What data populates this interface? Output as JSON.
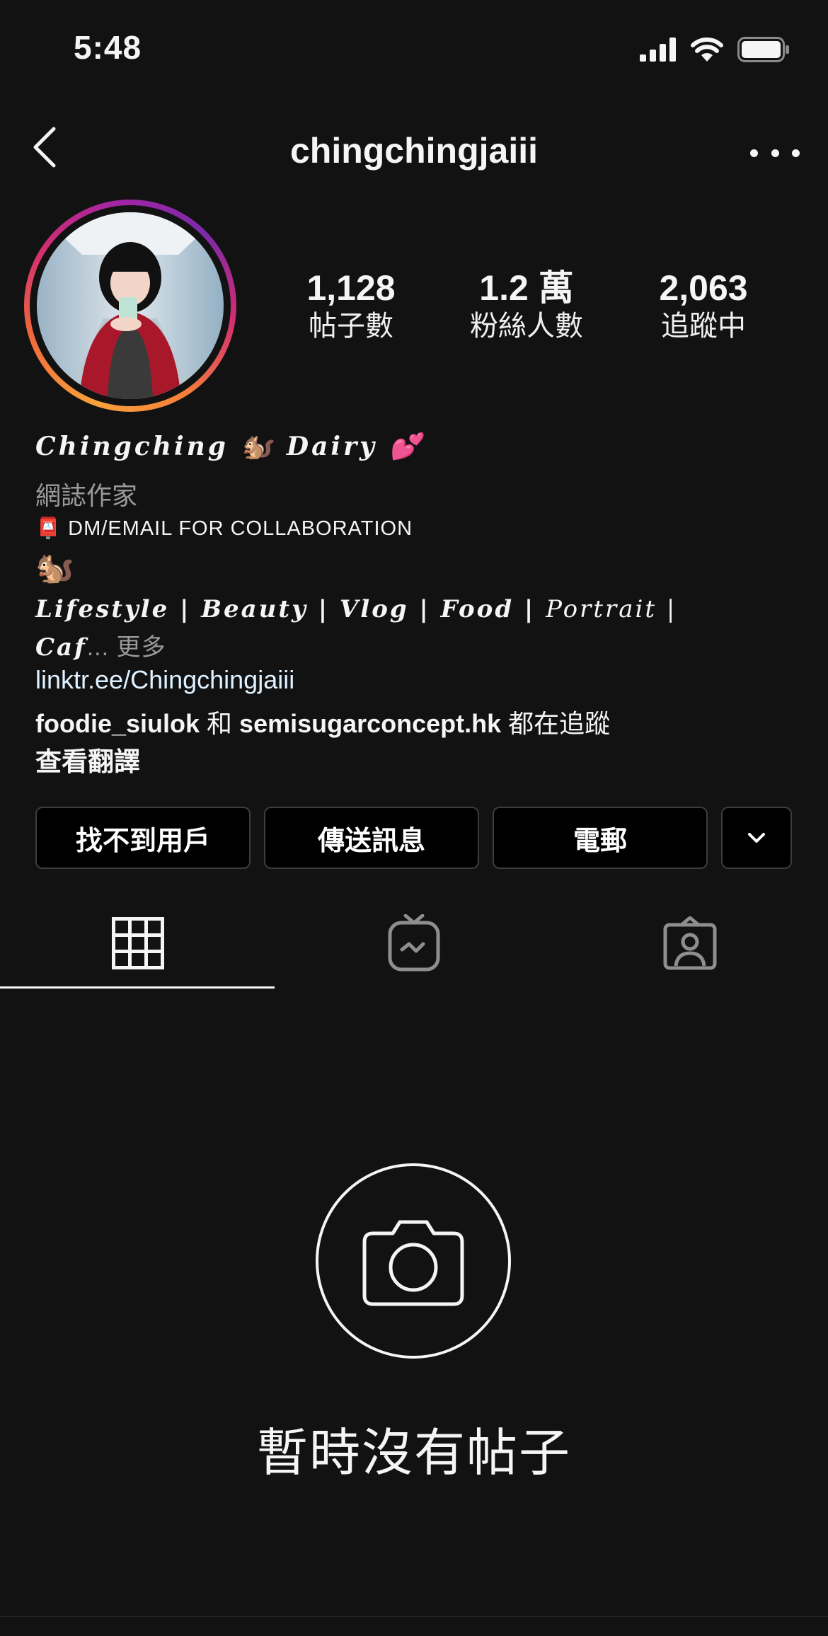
{
  "status_bar": {
    "time": "5:48"
  },
  "header": {
    "username": "chingchingjaiii"
  },
  "stats": [
    {
      "value": "1,128",
      "label": "帖子數"
    },
    {
      "value": "1.2 萬",
      "label": "粉絲人數"
    },
    {
      "value": "2,063",
      "label": "追蹤中"
    }
  ],
  "bio": {
    "display_name": "Chingching 🐿️ Dairy 💕",
    "category": "網誌作家",
    "contact_line": "📮 DM/EMAIL FOR COLLABORATION",
    "emoji_line": "🐿️",
    "tags_line1_bold": "Lifestyle | Beauty | Vlog | Food | ",
    "tags_line1_thin": "Portrait |",
    "tags_line2": "Caf",
    "more_label": "... 更多",
    "link": "linktr.ee/Chingchingjaiii",
    "followed_by_user1": "foodie_siulok",
    "followed_by_and": " 和 ",
    "followed_by_user2": "semisugarconcept.hk",
    "followed_by_suffix": " 都在追蹤",
    "translate": "查看翻譯"
  },
  "buttons": {
    "find_user": "找不到用戶",
    "message": "傳送訊息",
    "email": "電郵"
  },
  "tabs": [
    {
      "icon": "grid-icon",
      "active": true
    },
    {
      "icon": "igtv-icon",
      "active": false
    },
    {
      "icon": "tagged-icon",
      "active": false
    }
  ],
  "empty_state": {
    "text": "暫時沒有帖子",
    "icon": "camera-icon"
  },
  "colors": {
    "background": "#121212",
    "link": "#e0f1ff",
    "muted": "#9a9a9a"
  }
}
